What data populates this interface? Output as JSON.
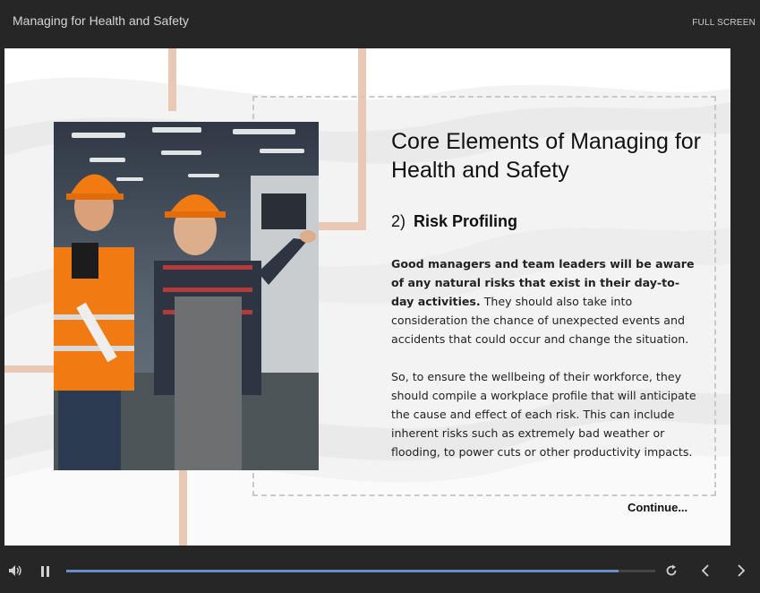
{
  "header": {
    "course_title": "Managing for Health and Safety",
    "fullscreen_label": "FULL SCREEN"
  },
  "slide": {
    "title": "Core Elements of Managing for Health and Safety",
    "section_number": "2)",
    "section_name": "Risk Profiling",
    "para1_bold": "Good managers and team leaders will be aware of any natural risks that exist in their day-to-day activities.",
    "para1_rest": " They should also take into consideration the chance of unexpected events and accidents that could occur and change the situation.",
    "para2": "So, to ensure the wellbeing of their workforce, they should compile a workplace profile that will anticipate the cause and effect of each risk. This can include inherent risks such as extremely bad weather or flooding, to power cuts or other productivity impacts.",
    "continue_label": "Continue..."
  },
  "player": {
    "progress": 0.938,
    "icons": [
      "volume-icon",
      "pause-icon",
      "replay-icon",
      "previous-icon",
      "next-icon"
    ]
  },
  "colors": {
    "accent_bar": "#e9c9b6",
    "progress": "#6a8fc6",
    "chrome": "#262626"
  }
}
